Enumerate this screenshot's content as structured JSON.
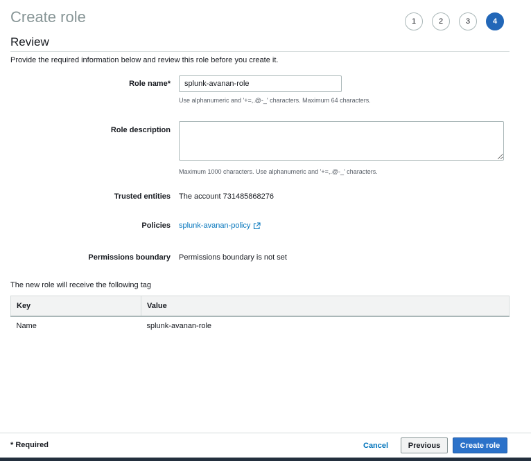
{
  "header": {
    "title": "Create role",
    "steps": [
      "1",
      "2",
      "3",
      "4"
    ],
    "active_step": "4"
  },
  "review": {
    "title": "Review",
    "intro": "Provide the required information below and review this role before you create it."
  },
  "form": {
    "role_name": {
      "label": "Role name*",
      "value": "splunk-avanan-role",
      "hint": "Use alphanumeric and '+=,.@-_' characters. Maximum 64 characters."
    },
    "role_description": {
      "label": "Role description",
      "value": "",
      "hint": "Maximum 1000 characters. Use alphanumeric and '+=,.@-_' characters."
    },
    "trusted_entities": {
      "label": "Trusted entities",
      "value": "The account 731485868276"
    },
    "policies": {
      "label": "Policies",
      "link": "splunk-avanan-policy",
      "icon": "external-link-icon"
    },
    "permissions_boundary": {
      "label": "Permissions boundary",
      "value": "Permissions boundary is not set"
    }
  },
  "tags": {
    "intro": "The new role will receive the following tag",
    "columns": [
      "Key",
      "Value"
    ],
    "rows": [
      {
        "key": "Name",
        "value": "splunk-avanan-role"
      }
    ]
  },
  "footer": {
    "required_note": "* Required",
    "cancel_label": "Cancel",
    "previous_label": "Previous",
    "create_label": "Create role"
  },
  "colors": {
    "primary": "#2c72c9",
    "link": "#0073bb",
    "active_step": "#2267b8"
  }
}
